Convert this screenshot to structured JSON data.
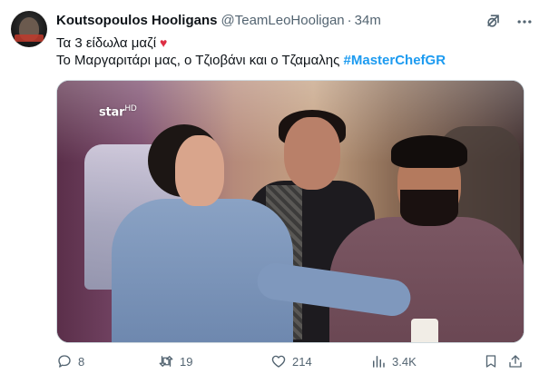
{
  "tweet": {
    "display_name": "Koutsopoulos Hooligans",
    "handle": "@TeamLeoHooligan",
    "separator": "·",
    "time": "34m",
    "line1": "Τα 3 είδωλα μαζί",
    "line2_text": "Το Μαργαριτάρι μας, ο Τζιοβάνι και ο Τζαμαλης",
    "hashtag": "#MasterChefGR",
    "emoji": "♥",
    "media_watermark": "star",
    "media_watermark_sup": "HD",
    "colors": {
      "accent": "#1d9bf0",
      "heart": "#dd2e44",
      "secondary_text": "#536471"
    }
  },
  "actions": {
    "replies": "8",
    "retweets": "19",
    "likes": "214",
    "views": "3.4K",
    "icons": [
      "reply-icon",
      "retweet-icon",
      "like-icon",
      "views-icon",
      "bookmark-icon",
      "share-icon"
    ]
  }
}
